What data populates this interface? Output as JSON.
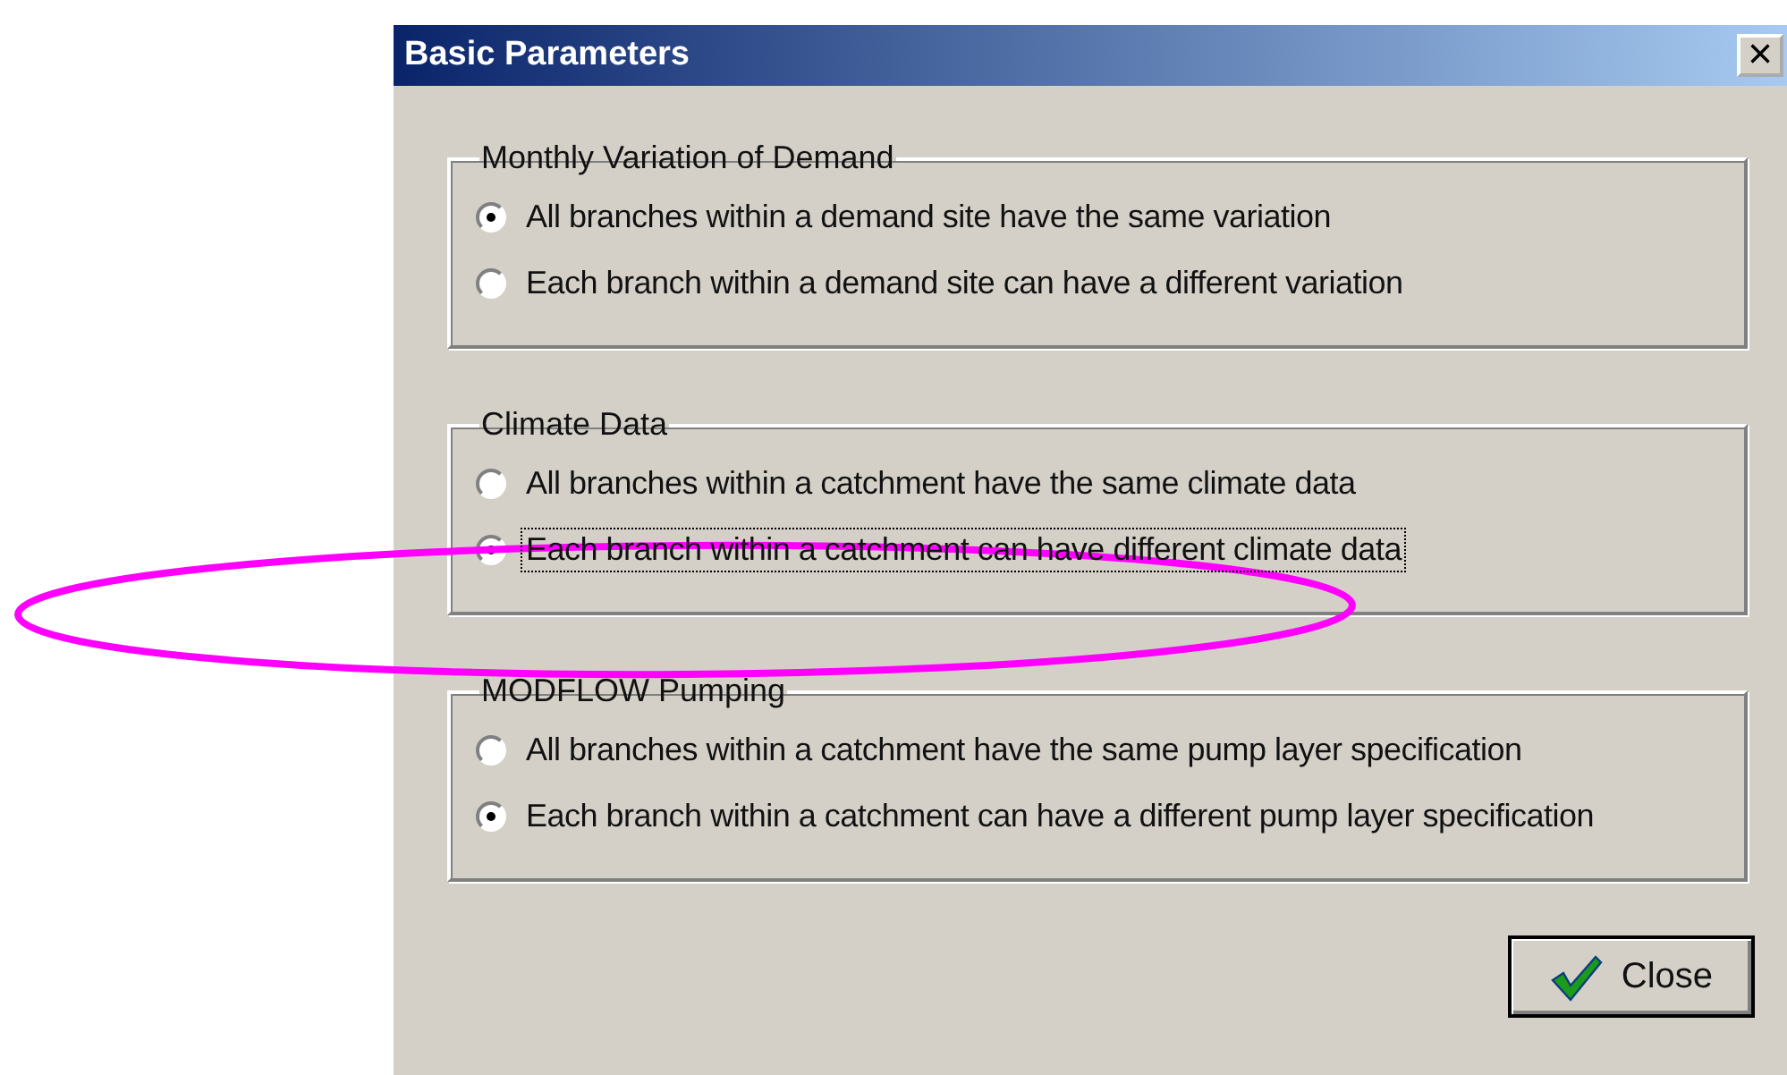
{
  "window": {
    "title": "Basic Parameters",
    "close_glyph": "×"
  },
  "groups": [
    {
      "title": "Monthly Variation of Demand",
      "options": [
        {
          "label": "All branches within a demand site have the same variation",
          "selected": true,
          "focused": false
        },
        {
          "label": "Each branch within a demand site can have a different variation",
          "selected": false,
          "focused": false
        }
      ]
    },
    {
      "title": "Climate Data",
      "options": [
        {
          "label": "All branches within a catchment have the same climate data",
          "selected": false,
          "focused": false
        },
        {
          "label": "Each branch within a catchment can have different climate data",
          "selected": true,
          "focused": true
        }
      ]
    },
    {
      "title": "MODFLOW Pumping",
      "options": [
        {
          "label": "All branches within a catchment have the same pump layer specification",
          "selected": false,
          "focused": false
        },
        {
          "label": "Each branch within a catchment can have a different pump layer specification",
          "selected": true,
          "focused": false
        }
      ]
    }
  ],
  "buttons": [
    {
      "label": "Close",
      "kind": "close"
    }
  ],
  "annotation": {
    "kind": "ellipse",
    "color": "#ff00ff"
  }
}
